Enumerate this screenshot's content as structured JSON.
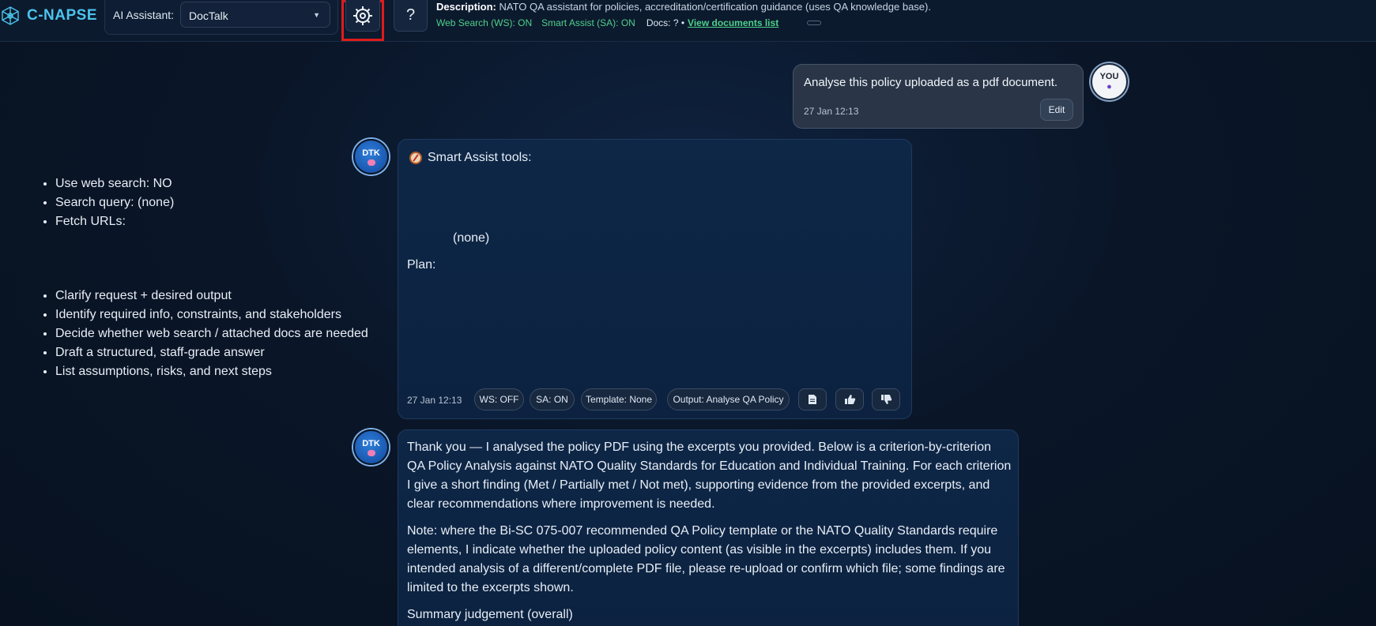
{
  "app": {
    "name": "C-NAPSE",
    "brand_color": "#4cc4ec"
  },
  "header": {
    "assistant_label": "AI Assistant:",
    "assistant_value": "DocTalk",
    "settings_icon": "gear-icon",
    "help_label": "?",
    "description_label": "Description:",
    "description_text": "NATO QA assistant for policies, accreditation/certification guidance (uses QA knowledge base).",
    "status_ws": "Web Search (WS): ON",
    "status_sa": "Smart Assist (SA): ON",
    "status_docs": "Docs: ? •",
    "status_link": "View documents list",
    "status_color": "#4ed08a"
  },
  "user_message": {
    "text": "Analyse this policy uploaded as a pdf document.",
    "time": "27 Jan 12:13",
    "edit_label": "Edit",
    "avatar_label": "YOU"
  },
  "bot_avatar_label": "DTK",
  "bot_message_1": {
    "title": "Smart Assist tools:",
    "tools": [
      "Use web search: NO",
      "Search query: (none)",
      "Fetch URLs:"
    ],
    "tools_continuation": "(none)",
    "plan_label": "Plan:",
    "plan": [
      "Clarify request + desired output",
      "Identify required info, constraints, and stakeholders",
      "Decide whether web search / attached docs are needed",
      "Draft a structured, staff-grade answer",
      "List assumptions, risks, and next steps"
    ],
    "time": "27 Jan 12:13",
    "chips": {
      "ws": "WS: OFF",
      "sa": "SA: ON",
      "template": "Template: None",
      "output": "Output: Analyse QA Policy"
    },
    "actions": [
      "document-icon",
      "thumbs-up-icon",
      "thumbs-down-icon"
    ]
  },
  "bot_message_2": {
    "para1": "Thank you — I analysed the policy PDF using the excerpts you provided. Below is a criterion-by-criterion QA Policy Analysis against NATO Quality Standards for Education and Individual Training. For each criterion I give a short finding (Met / Partially met / Not met), supporting evidence from the provided excerpts, and clear recommendations where improvement is needed.",
    "para2": "Note: where the Bi-SC 075-007 recommended QA Policy template or the NATO Quality Standards require elements, I indicate whether the uploaded policy content (as visible in the excerpts) includes them. If you intended analysis of a different/complete PDF file, please re-upload or confirm which file; some findings are limited to the excerpts shown.",
    "para3": "Summary judgement (overall)"
  }
}
